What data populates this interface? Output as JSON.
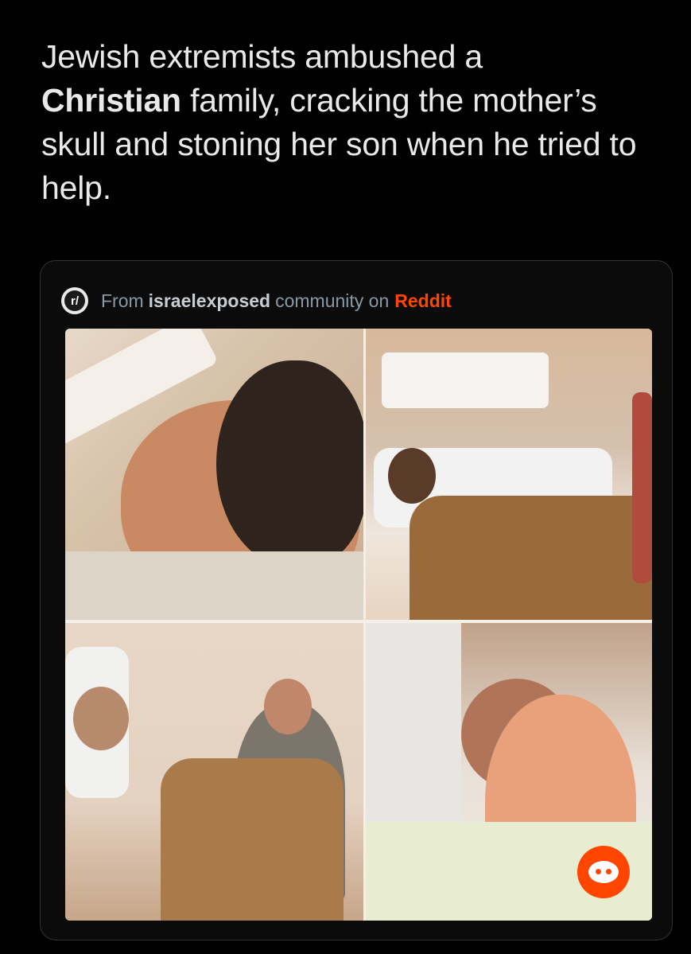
{
  "tweet": {
    "text_part1": "Jewish extremists ambushed a",
    "text_bold": "Christian",
    "text_part2": " family, cracking the mother’s skull and stoning her son when he tried to help."
  },
  "card": {
    "badge_label": "r/",
    "prefix": "From",
    "community": "israelexposed",
    "middle": "community on",
    "platform": "Reddit"
  },
  "icons": {
    "reddit_badge": "reddit-icon",
    "reddit_logo": "snoo-icon"
  },
  "colors": {
    "background": "#000000",
    "text": "#e7e9ea",
    "muted": "#8b98a5",
    "reddit": "#ff4500"
  }
}
